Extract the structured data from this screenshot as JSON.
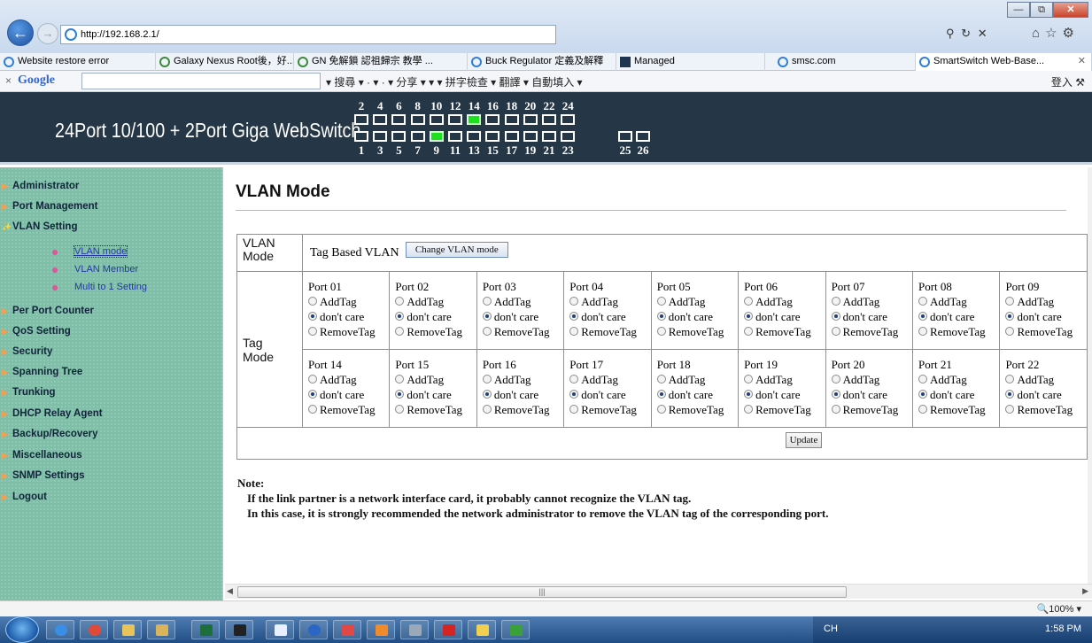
{
  "browser": {
    "address": "http://192.168.2.1/",
    "tabs": [
      {
        "label": "Website restore error",
        "icon": "ie-icon"
      },
      {
        "label": "Galaxy Nexus Root後，好...",
        "icon": "gn-icon"
      },
      {
        "label": "GN 免解鎖 認祖歸宗 教學 ...",
        "icon": "gn-icon"
      },
      {
        "label": "Buck Regulator 定義及解釋",
        "icon": "ie-icon"
      },
      {
        "label": "Managed",
        "icon": "managed-icon"
      },
      {
        "label": "smsc.com",
        "icon": "ie-icon"
      },
      {
        "label": "SmartSwitch Web-Base...",
        "icon": "ie-icon",
        "active": true
      }
    ],
    "google_label": "Google",
    "google_tools": "▾ 搜尋 ▾  ·  ▾  ·  ▾   分享 ▾   ▾   ▾    拼字檢查 ▾   翻譯 ▾   自動填入 ▾",
    "google_signin": "登入",
    "zoom": "100%"
  },
  "header": {
    "title": "24Port 10/100 + 2Port Giga WebSwitch",
    "top_port_numbers": [
      "2",
      "4",
      "6",
      "8",
      "10",
      "12",
      "14",
      "16",
      "18",
      "20",
      "22",
      "24"
    ],
    "bottom_port_numbers": [
      "1",
      "3",
      "5",
      "7",
      "9",
      "11",
      "13",
      "15",
      "17",
      "19",
      "21",
      "23"
    ],
    "giga_port_numbers": [
      "25",
      "26"
    ],
    "active_top_ports": [
      "14"
    ],
    "active_bottom_ports": [
      "9"
    ],
    "link_color": "#1ee01e"
  },
  "sidebar": {
    "items": [
      {
        "label": "Administrator"
      },
      {
        "label": "Port Management"
      },
      {
        "label": "VLAN Setting"
      },
      {
        "label": "Per Port Counter"
      },
      {
        "label": "QoS Setting"
      },
      {
        "label": "Security"
      },
      {
        "label": "Spanning Tree"
      },
      {
        "label": "Trunking"
      },
      {
        "label": "DHCP Relay Agent"
      },
      {
        "label": "Backup/Recovery"
      },
      {
        "label": "Miscellaneous"
      },
      {
        "label": "SNMP Settings"
      },
      {
        "label": "Logout"
      }
    ],
    "vlan_subitems": [
      {
        "label": "VLAN mode",
        "selected": true
      },
      {
        "label": "VLAN Member"
      },
      {
        "label": "Multi to 1 Setting"
      }
    ]
  },
  "main": {
    "title": "VLAN Mode",
    "vlan_mode_label": "VLAN Mode",
    "vlan_mode_value": "Tag Based VLAN",
    "change_button": "Change VLAN mode",
    "tag_mode_label": "Tag Mode",
    "options": [
      "AddTag",
      "don't care",
      "RemoveTag"
    ],
    "row1_ports": [
      {
        "name": "Port 01",
        "selected": "don't care"
      },
      {
        "name": "Port 02",
        "selected": "don't care"
      },
      {
        "name": "Port 03",
        "selected": "don't care"
      },
      {
        "name": "Port 04",
        "selected": "don't care"
      },
      {
        "name": "Port 05",
        "selected": "don't care"
      },
      {
        "name": "Port 06",
        "selected": "don't care"
      },
      {
        "name": "Port 07",
        "selected": "don't care"
      },
      {
        "name": "Port 08",
        "selected": "don't care"
      },
      {
        "name": "Port 09",
        "selected": "don't care"
      }
    ],
    "row2_ports": [
      {
        "name": "Port 14",
        "selected": "don't care"
      },
      {
        "name": "Port 15",
        "selected": "don't care"
      },
      {
        "name": "Port 16",
        "selected": "don't care"
      },
      {
        "name": "Port 17",
        "selected": "don't care"
      },
      {
        "name": "Port 18",
        "selected": "don't care"
      },
      {
        "name": "Port 19",
        "selected": "don't care"
      },
      {
        "name": "Port 20",
        "selected": "don't care"
      },
      {
        "name": "Port 21",
        "selected": "don't care"
      },
      {
        "name": "Port 22",
        "selected": "don't care"
      }
    ],
    "update_button": "Update",
    "note_title": "Note:",
    "note_line1": "If the link partner is a network interface card, it probably cannot recognize the VLAN tag.",
    "note_line2": "In this case, it is strongly recommended the network administrator to remove the VLAN tag of the corresponding port."
  },
  "taskbar": {
    "ime": "CH",
    "clock": "1:58 PM"
  }
}
